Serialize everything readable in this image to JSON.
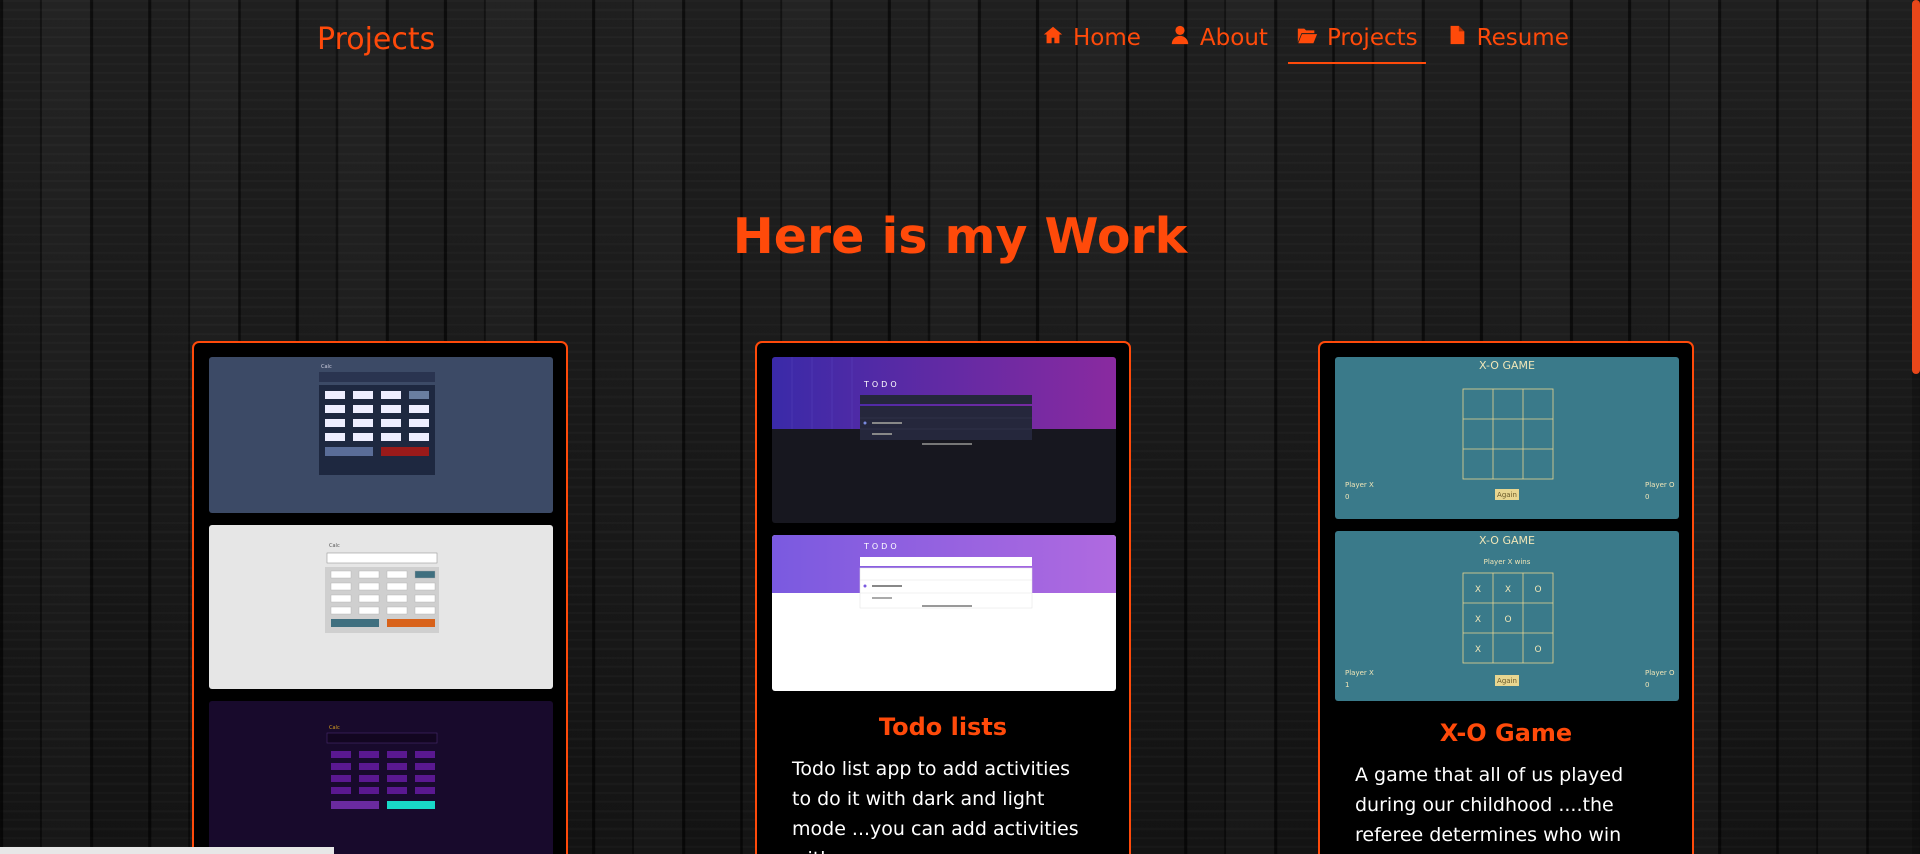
{
  "nav": {
    "brand": "Projects",
    "links": [
      {
        "label": "Home",
        "icon": "home-icon"
      },
      {
        "label": "About",
        "icon": "user-icon"
      },
      {
        "label": "Projects",
        "icon": "folder-open-icon",
        "active": true
      },
      {
        "label": "Resume",
        "icon": "file-icon"
      }
    ]
  },
  "main": {
    "heading": "Here is my Work"
  },
  "cards": [
    {
      "name": "calculator",
      "shots": [
        {
          "label": "Calc",
          "theme": "dark-blue"
        },
        {
          "label": "Calc",
          "theme": "light"
        },
        {
          "label": "Calc",
          "theme": "purple"
        }
      ]
    },
    {
      "name": "todo",
      "title": "Todo lists",
      "description": "Todo list app to add activities to do it with dark and light mode ...you can add activities with",
      "shots": [
        {
          "label": "TODO",
          "theme": "dark"
        },
        {
          "label": "TODO",
          "theme": "light"
        }
      ]
    },
    {
      "name": "xo-game",
      "title": "X-O Game",
      "description": "A game that all of us played during our childhood ....the referee determines who win and i",
      "shots": [
        {
          "title": "X-O GAME",
          "player_x": "Player X",
          "player_o": "Player O",
          "score_x": "0",
          "score_o": "0",
          "button": "Again"
        },
        {
          "title": "X-O GAME",
          "status": "Player X wins",
          "player_x": "Player X",
          "player_o": "Player O",
          "score_x": "1",
          "score_o": "0",
          "button": "Again",
          "board": [
            "X",
            "X",
            "O",
            "X",
            "O",
            "",
            "X",
            "",
            "O"
          ]
        }
      ]
    }
  ],
  "colors": {
    "accent": "#ff4a0a",
    "card_bg": "#000000",
    "page_bg": "#161616"
  }
}
